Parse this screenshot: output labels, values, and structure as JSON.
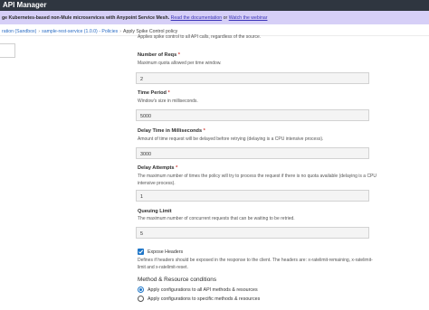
{
  "header": {
    "app_title": "API Manager"
  },
  "banner": {
    "text": "ge Kubernetes-based non-Mule microservices with Anypoint Service Mesh.",
    "doc_link": "Read the documentation",
    "or_text": "or",
    "webinar_link": "Watch the webinar"
  },
  "breadcrumb": {
    "environment": "ration (Sandbox)",
    "api": "sample-rest-service (1.0.0) - Policies",
    "current": "Apply Spike Control policy"
  },
  "form": {
    "intro": "Applies spike control to all API calls, regardless of the source.",
    "required_mark": "*",
    "fields": [
      {
        "label": "Number of Reqs",
        "required": true,
        "help": "Maximum quota allowed per time window.",
        "value": "2"
      },
      {
        "label": "Time Period",
        "required": true,
        "help": "Window's size in milliseconds.",
        "value": "5000"
      },
      {
        "label": "Delay Time in Milliseconds",
        "required": true,
        "help": "Amount of time request will be delayed before retrying (delaying is a CPU intensive process).",
        "value": "3000"
      },
      {
        "label": "Delay Attempts",
        "required": true,
        "help": "The maximum number of times the policy will try to process the request if there is no quota available (delaying is a CPU intensive process).",
        "value": "1"
      },
      {
        "label": "Queuing Limit",
        "required": false,
        "help": "The maximum number of concurrent requests that can be waiting to be retried.",
        "value": "5"
      }
    ],
    "expose_headers": {
      "label": "Expose Headers",
      "checked": true,
      "help": "Defines if headers should be exposed in the response to the client. The headers are: x-ratelimit-remaining, x-ratelimit-limit and x-ratelimit-reset."
    },
    "method_section": {
      "title": "Method & Resource conditions",
      "options": [
        {
          "label": "Apply configurations to all API methods & resources",
          "selected": true
        },
        {
          "label": "Apply configurations to specific methods & resources",
          "selected": false
        }
      ]
    }
  },
  "colors": {
    "topbar": "#2f3640",
    "banner": "#d6cff7",
    "accent": "#1f76c8",
    "required": "#d43f3a"
  }
}
